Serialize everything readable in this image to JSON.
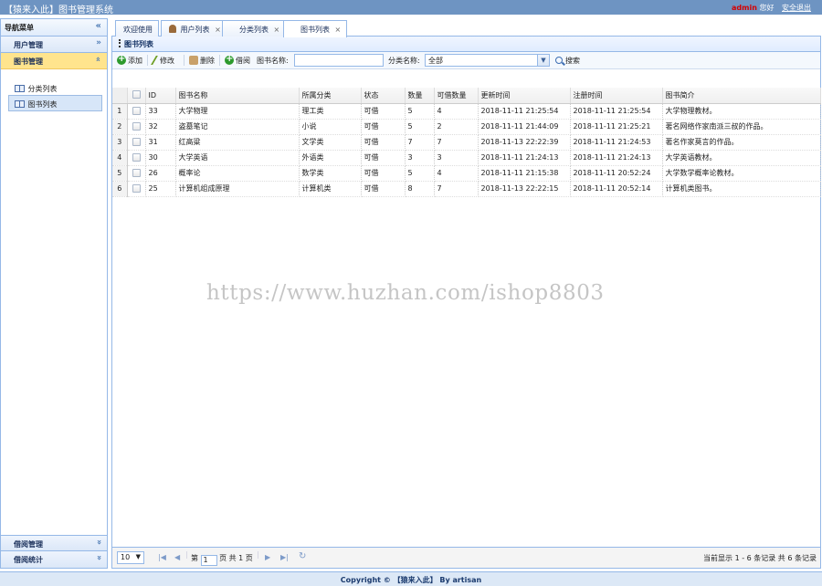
{
  "app": {
    "title": "【猿来入此】图书管理系统",
    "user": "admin",
    "greeting": "您好",
    "logout": "安全退出"
  },
  "sidebar": {
    "header": "导航菜单",
    "collapse_icon": "double-chevron-left-icon",
    "groups": [
      {
        "label": "用户管理"
      },
      {
        "label": "图书管理"
      },
      {
        "label": "借阅管理"
      },
      {
        "label": "借阅统计"
      }
    ],
    "items": [
      {
        "label": "分类列表"
      },
      {
        "label": "图书列表"
      }
    ]
  },
  "tabs": [
    {
      "label": "欢迎使用"
    },
    {
      "label": "用户列表"
    },
    {
      "label": "分类列表"
    },
    {
      "label": "图书列表"
    }
  ],
  "panel": {
    "title": "图书列表"
  },
  "toolbar": {
    "add": "添加",
    "edit": "修改",
    "delete": "删除",
    "borrow": "借阅",
    "name_label": "图书名称:",
    "name_value": "",
    "category_label": "分类名称:",
    "category_value": "全部",
    "search": "搜索"
  },
  "grid": {
    "columns": [
      "ID",
      "图书名称",
      "所属分类",
      "状态",
      "数量",
      "可借数量",
      "更新时间",
      "注册时间",
      "图书简介"
    ],
    "rows": [
      {
        "rn": "1",
        "id": "33",
        "name": "大学物理",
        "category": "理工类",
        "status": "可借",
        "qty": "5",
        "avail": "4",
        "updated": "2018-11-11 21:25:54",
        "registered": "2018-11-11 21:25:54",
        "intro": "大学物理教材。"
      },
      {
        "rn": "2",
        "id": "32",
        "name": "盗墓笔记",
        "category": "小说",
        "status": "可借",
        "qty": "5",
        "avail": "2",
        "updated": "2018-11-11 21:44:09",
        "registered": "2018-11-11 21:25:21",
        "intro": "著名网络作家南派三叔的作品。"
      },
      {
        "rn": "3",
        "id": "31",
        "name": "红高粱",
        "category": "文学类",
        "status": "可借",
        "qty": "7",
        "avail": "7",
        "updated": "2018-11-13 22:22:39",
        "registered": "2018-11-11 21:24:53",
        "intro": "著名作家莫言的作品。"
      },
      {
        "rn": "4",
        "id": "30",
        "name": "大学英语",
        "category": "外语类",
        "status": "可借",
        "qty": "3",
        "avail": "3",
        "updated": "2018-11-11 21:24:13",
        "registered": "2018-11-11 21:24:13",
        "intro": "大学英语教材。"
      },
      {
        "rn": "5",
        "id": "26",
        "name": "概率论",
        "category": "数学类",
        "status": "可借",
        "qty": "5",
        "avail": "4",
        "updated": "2018-11-11 21:15:38",
        "registered": "2018-11-11 20:52:24",
        "intro": "大学数学概率论教材。"
      },
      {
        "rn": "6",
        "id": "25",
        "name": "计算机组成原理",
        "category": "计算机类",
        "status": "可借",
        "qty": "8",
        "avail": "7",
        "updated": "2018-11-13 22:22:15",
        "registered": "2018-11-11 20:52:14",
        "intro": "计算机类图书。"
      }
    ]
  },
  "pager": {
    "page_size": "10",
    "page_prefix": "第",
    "page_value": "1",
    "page_suffix": "页 共 1 页",
    "summary": "当前显示 1 - 6 条记录 共 6 条记录"
  },
  "watermark": "https://www.huzhan.com/ishop8803",
  "footer": "Copyright © 【猿来入此】 By artisan"
}
